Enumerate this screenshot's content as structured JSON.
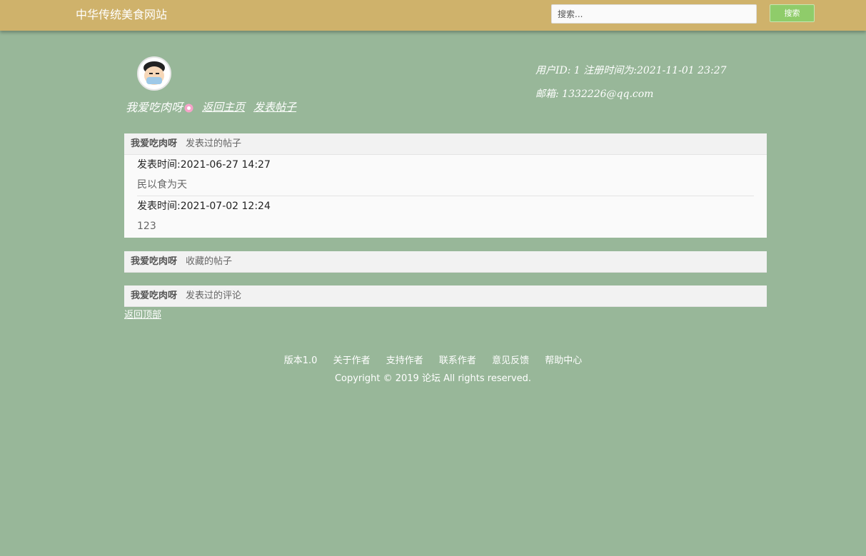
{
  "navbar": {
    "brand": "中华传统美食网站",
    "search_placeholder": "搜索...",
    "search_button": "搜索"
  },
  "profile": {
    "username": "我爱吃肉呀",
    "back_home": "返回主页",
    "post_link": "发表帖子",
    "meta": "用户ID: 1  注册时间为:2021-11-01 23:27",
    "email": "邮箱: 1332226@qq.com"
  },
  "posts_panel": {
    "user": "我爱吃肉呀",
    "title": "发表过的帖子",
    "items": [
      {
        "time": "发表时间:2021-06-27 14:27",
        "title": "民以食为天"
      },
      {
        "time": "发表时间:2021-07-02 12:24",
        "title": "123"
      }
    ]
  },
  "favorites_panel": {
    "user": "我爱吃肉呀",
    "title": "收藏的帖子"
  },
  "comments_panel": {
    "user": "我爱吃肉呀",
    "title": "发表过的评论"
  },
  "back_top": "返回顶部",
  "footer": {
    "links": [
      "版本1.0",
      "关于作者",
      "支持作者",
      "联系作者",
      "意见反馈",
      "帮助中心"
    ],
    "copyright": "Copyright © 2019 论坛 All rights reserved."
  },
  "colors": {
    "background": "#98b799",
    "navbar": "#cfb26b",
    "search_button": "#8fcc6a"
  }
}
